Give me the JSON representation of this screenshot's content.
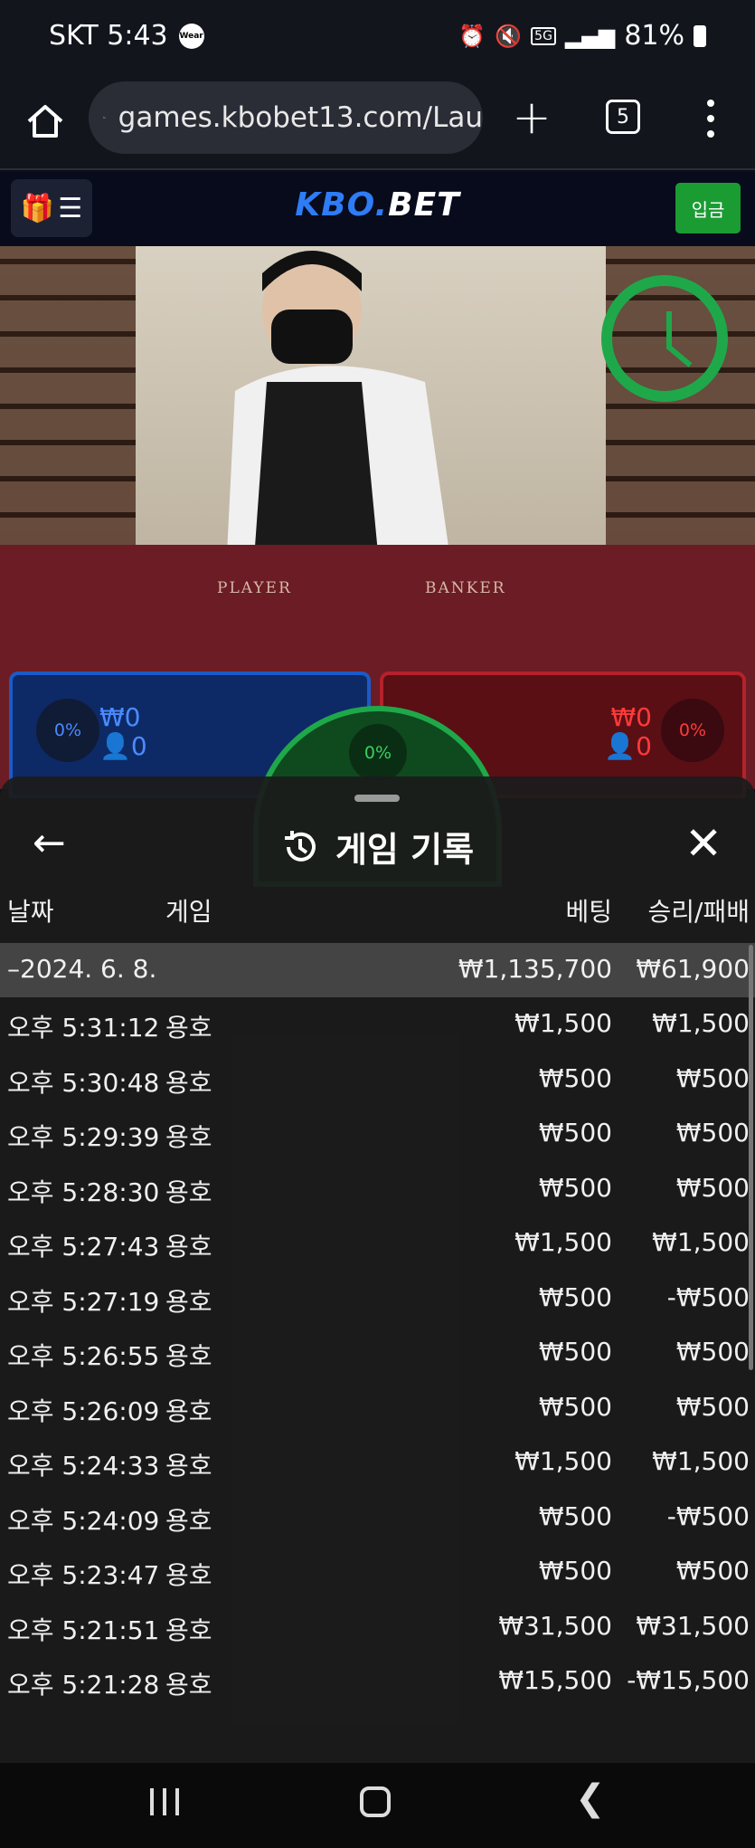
{
  "status_bar": {
    "carrier_time": "SKT 5:43",
    "wear_badge": "Wear",
    "battery": "81%",
    "network": "5G"
  },
  "browser": {
    "url": "games.kbobet13.com/Lau",
    "tab_count": "5"
  },
  "site": {
    "logo_kbo": "KBO",
    "logo_dot": ".",
    "logo_bet": "BET",
    "deposit_label": "입금"
  },
  "game_view": {
    "player_label": "PLAYER",
    "banker_label": "BANKER",
    "player_pct": "0%",
    "player_amount": "₩0",
    "player_count": "0",
    "banker_pct": "0%",
    "banker_amount": "₩0",
    "banker_count": "0",
    "tie_pct": "0%"
  },
  "history_modal": {
    "title": "게임 기록",
    "columns": {
      "date": "날짜",
      "game": "게임",
      "bet": "베팅",
      "win_loss": "승리/패배"
    },
    "date_row": {
      "date": "–2024. 6. 8.",
      "bet": "₩1,135,700",
      "win_loss": "₩61,900"
    },
    "rows": [
      {
        "time": "오후 5:31:12",
        "game": "용호",
        "bet": "₩1,500",
        "win_loss": "₩1,500"
      },
      {
        "time": "오후 5:30:48",
        "game": "용호",
        "bet": "₩500",
        "win_loss": "₩500"
      },
      {
        "time": "오후 5:29:39",
        "game": "용호",
        "bet": "₩500",
        "win_loss": "₩500"
      },
      {
        "time": "오후 5:28:30",
        "game": "용호",
        "bet": "₩500",
        "win_loss": "₩500"
      },
      {
        "time": "오후 5:27:43",
        "game": "용호",
        "bet": "₩1,500",
        "win_loss": "₩1,500"
      },
      {
        "time": "오후 5:27:19",
        "game": "용호",
        "bet": "₩500",
        "win_loss": "-₩500"
      },
      {
        "time": "오후 5:26:55",
        "game": "용호",
        "bet": "₩500",
        "win_loss": "₩500"
      },
      {
        "time": "오후 5:26:09",
        "game": "용호",
        "bet": "₩500",
        "win_loss": "₩500"
      },
      {
        "time": "오후 5:24:33",
        "game": "용호",
        "bet": "₩1,500",
        "win_loss": "₩1,500"
      },
      {
        "time": "오후 5:24:09",
        "game": "용호",
        "bet": "₩500",
        "win_loss": "-₩500"
      },
      {
        "time": "오후 5:23:47",
        "game": "용호",
        "bet": "₩500",
        "win_loss": "₩500"
      },
      {
        "time": "오후 5:21:51",
        "game": "용호",
        "bet": "₩31,500",
        "win_loss": "₩31,500"
      },
      {
        "time": "오후 5:21:28",
        "game": "용호",
        "bet": "₩15,500",
        "win_loss": "-₩15,500"
      }
    ]
  },
  "colors": {
    "accent_blue": "#2e7cf6",
    "deposit_green": "#1a9c33",
    "player_blue": "#1c5ac8",
    "banker_red": "#b4222b",
    "tie_green": "#1fa84a"
  }
}
